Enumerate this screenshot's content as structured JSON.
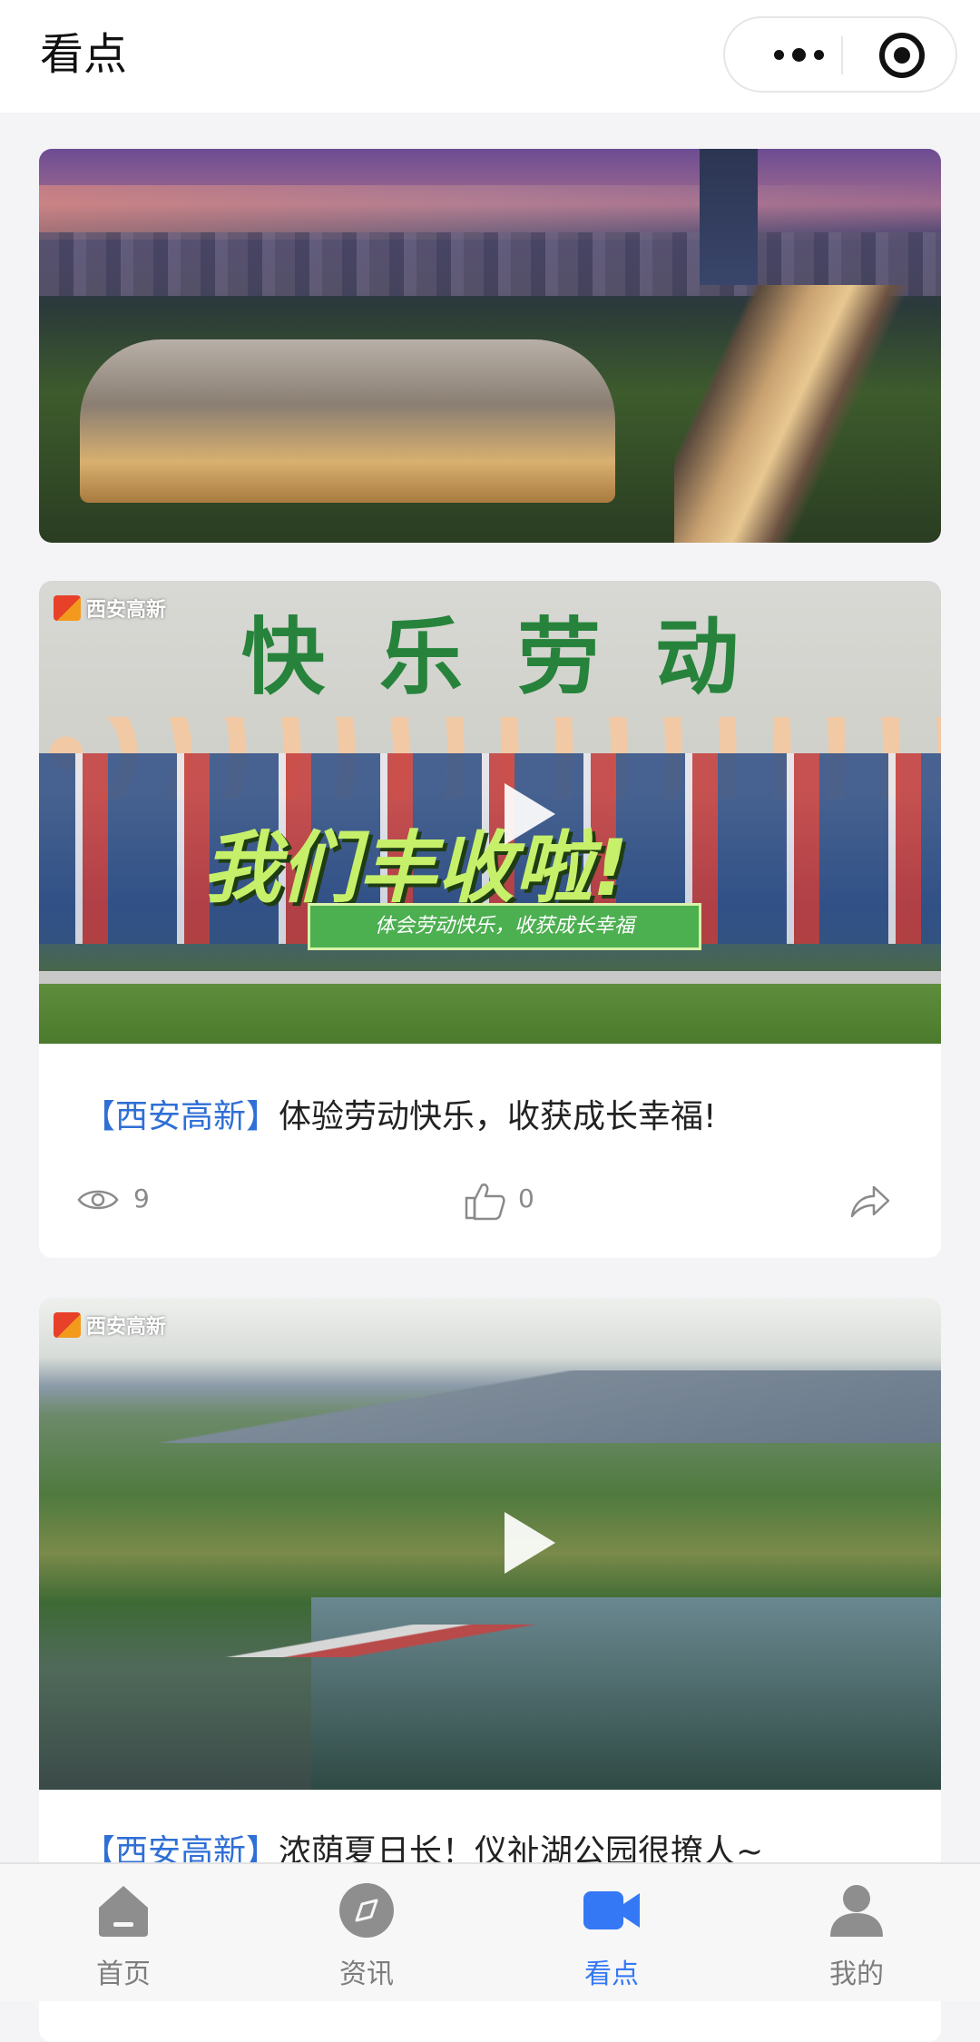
{
  "header": {
    "title": "看点"
  },
  "cards": [
    {
      "brand": "西安高新",
      "headline": "快乐劳动",
      "slogan": "我们丰收啦!",
      "subbanner": "体会劳动快乐，收获成长幸福",
      "tag": "【西安高新】",
      "title": "体验劳动快乐，收获成长幸福!",
      "views": "9",
      "likes": "0"
    },
    {
      "brand": "西安高新",
      "tag": "【西安高新】",
      "title": "浓荫夏日长！仪祉湖公园很撩人~"
    }
  ],
  "tabbar": {
    "items": [
      {
        "label": "首页",
        "icon": "home-icon"
      },
      {
        "label": "资讯",
        "icon": "compass-icon"
      },
      {
        "label": "看点",
        "icon": "video-camera-icon",
        "active": true
      },
      {
        "label": "我的",
        "icon": "user-icon"
      }
    ]
  },
  "colors": {
    "accent": "#3478f6",
    "tag": "#2f6fd6",
    "background": "#f4f4f7"
  }
}
